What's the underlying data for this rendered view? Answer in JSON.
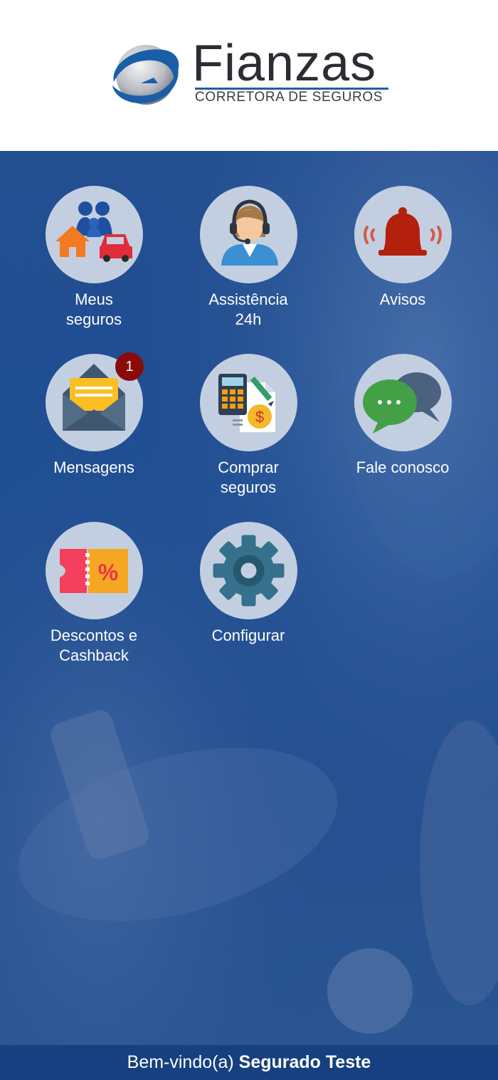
{
  "brand": {
    "name": "Fianzas",
    "tagline": "CORRETORA DE SEGUROS",
    "logo_icon": "globe-swoosh-logo"
  },
  "menu": [
    {
      "id": "meus-seguros",
      "lines": [
        "Meus",
        "seguros"
      ],
      "icon": "family-house-car-icon"
    },
    {
      "id": "assistencia-24h",
      "lines": [
        "Assistência",
        "24h"
      ],
      "icon": "support-agent-icon"
    },
    {
      "id": "avisos",
      "lines": [
        "Avisos"
      ],
      "icon": "bell-icon"
    },
    {
      "id": "mensagens",
      "lines": [
        "Mensagens"
      ],
      "icon": "envelope-icon",
      "badge": "1"
    },
    {
      "id": "comprar-seguros",
      "lines": [
        "Comprar",
        "seguros"
      ],
      "icon": "calculator-document-icon"
    },
    {
      "id": "fale-conosco",
      "lines": [
        "Fale conosco"
      ],
      "icon": "chat-bubbles-icon"
    },
    {
      "id": "descontos-cashback",
      "lines": [
        "Descontos e",
        "Cashback"
      ],
      "icon": "discount-coupon-icon"
    },
    {
      "id": "configurar",
      "lines": [
        "Configurar"
      ],
      "icon": "gear-icon"
    }
  ],
  "footer": {
    "greeting": "Bem-vindo(a)",
    "user_name": "Segurado Teste"
  },
  "colors": {
    "header_bg": "#ffffff",
    "main_bg": "#1f4e92",
    "tile_circle": "#c3cfe0",
    "badge": "#8a0a0a",
    "footer_bg": "#16407f"
  }
}
